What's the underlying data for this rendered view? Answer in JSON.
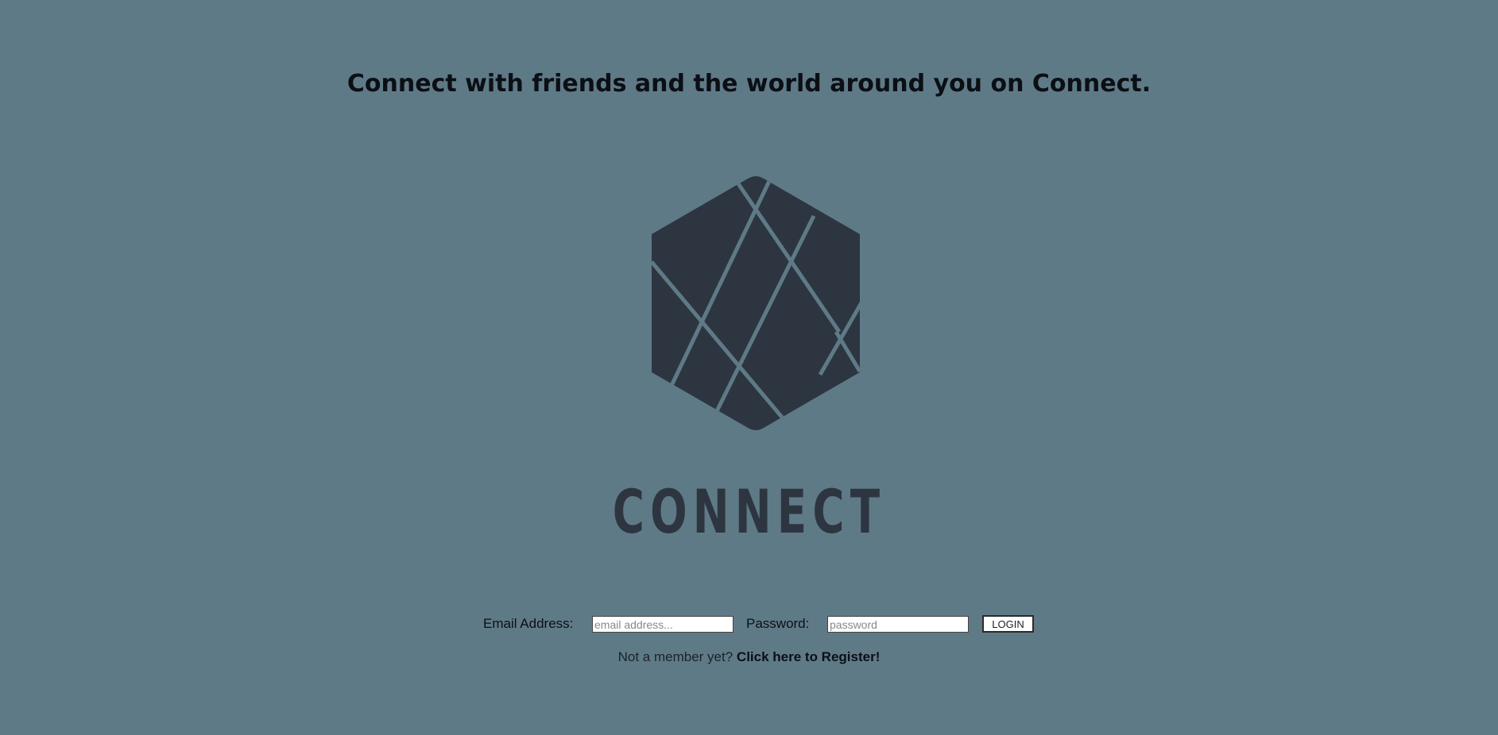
{
  "header": {
    "headline": "Connect with friends and the world around you on Connect."
  },
  "logo": {
    "icon": "hexagon-logo-icon",
    "wordmark": "CONNECT",
    "color": "#2d3640",
    "line_color": "#5f7a87"
  },
  "login": {
    "email_label": "Email Address:",
    "email_placeholder": "email address...",
    "email_value": "",
    "password_label": "Password:",
    "password_placeholder": "password",
    "password_value": "",
    "button_label": "LOGIN"
  },
  "register": {
    "prompt": "Not a member yet?",
    "link_text": "Click here to Register!"
  },
  "colors": {
    "background": "#5f7a87",
    "text": "#0b0f14"
  }
}
